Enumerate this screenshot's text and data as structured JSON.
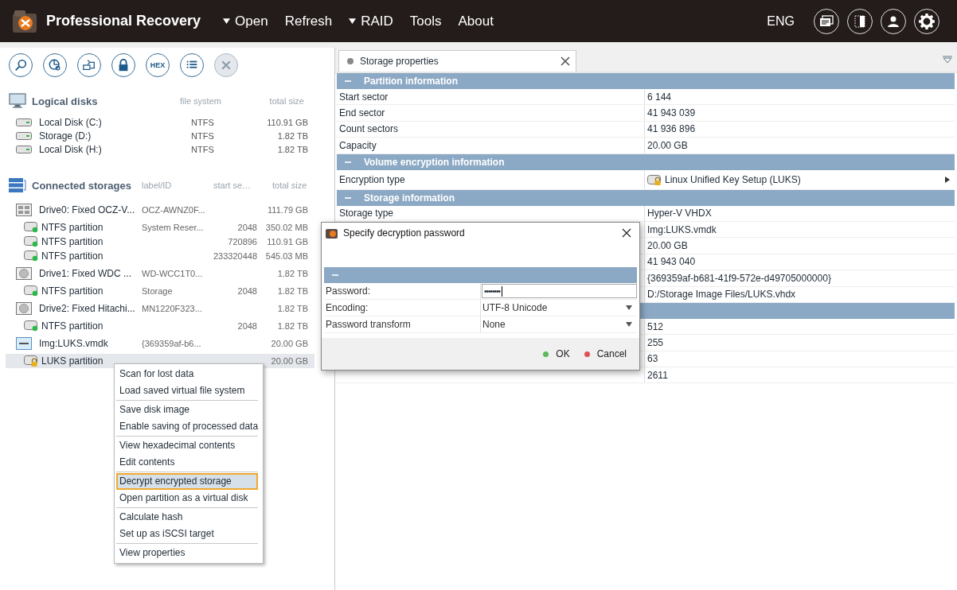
{
  "app": {
    "title": "Professional Recovery",
    "language": "ENG",
    "menu": [
      {
        "label": "Open",
        "caret": true
      },
      {
        "label": "Refresh",
        "caret": false
      },
      {
        "label": "RAID",
        "caret": true
      },
      {
        "label": "Tools",
        "caret": false
      },
      {
        "label": "About",
        "caret": false
      }
    ],
    "header_buttons": [
      {
        "kind": "windows"
      },
      {
        "kind": "panel"
      },
      {
        "kind": "user"
      },
      {
        "kind": "settings"
      }
    ]
  },
  "toolbar": [
    {
      "kind": "search",
      "disabled": false
    },
    {
      "kind": "chart",
      "disabled": false
    },
    {
      "kind": "image",
      "disabled": false
    },
    {
      "kind": "lock",
      "disabled": false
    },
    {
      "kind": "hex",
      "label": "HEX",
      "disabled": false
    },
    {
      "kind": "list",
      "disabled": false
    },
    {
      "kind": "close",
      "disabled": true
    }
  ],
  "logical_disks": {
    "title": "Logical disks",
    "columns": [
      "file system",
      "total size"
    ],
    "items": [
      {
        "name": "Local Disk (C:)",
        "fs": "NTFS",
        "size": "110.91 GB"
      },
      {
        "name": "Storage (D:)",
        "fs": "NTFS",
        "size": "1.82 TB"
      },
      {
        "name": "Local Disk (H:)",
        "fs": "NTFS",
        "size": "1.82 TB"
      }
    ]
  },
  "connected_storages": {
    "title": "Connected storages",
    "columns": [
      "label/ID",
      "start se…",
      "total size"
    ],
    "items": [
      {
        "kind": "ssd",
        "name": "Drive0: Fixed OCZ-V...",
        "label": "OCZ-AWNZ0F...",
        "size": "111.79 GB",
        "selected": false,
        "children": [
          {
            "kind": "ntfs",
            "name": "NTFS partition",
            "label": "System Reser...",
            "start": "2048",
            "size": "350.02 MB",
            "selected": false
          },
          {
            "kind": "ntfs",
            "name": "NTFS partition",
            "start": "720896",
            "size": "110.91 GB",
            "selected": false
          },
          {
            "kind": "ntfs",
            "name": "NTFS partition",
            "start": "233320448",
            "size": "545.03 MB",
            "selected": false
          }
        ]
      },
      {
        "kind": "hdd",
        "name": "Drive1: Fixed WDC ...",
        "label": "WD-WCC1T0...",
        "size": "1.82 TB",
        "selected": false,
        "children": [
          {
            "kind": "ntfs",
            "name": "NTFS partition",
            "label": "Storage",
            "start": "2048",
            "size": "1.82 TB",
            "selected": false
          }
        ]
      },
      {
        "kind": "hdd",
        "name": "Drive2: Fixed Hitachi...",
        "label": "MN1220F323...",
        "size": "1.82 TB",
        "selected": false,
        "children": [
          {
            "kind": "ntfs",
            "name": "NTFS partition",
            "start": "2048",
            "size": "1.82 TB",
            "selected": false
          }
        ]
      },
      {
        "kind": "image",
        "name": "Img:LUKS.vmdk",
        "label": "{369359af-b6...",
        "size": "20.00 GB",
        "selected": false,
        "children": [
          {
            "kind": "luks",
            "name": "LUKS partition",
            "size": "20.00 GB",
            "selected": true
          }
        ]
      }
    ]
  },
  "properties": {
    "tab": {
      "label": "Storage properties",
      "selected": true
    },
    "sections": [
      {
        "title": "Partition information",
        "expanded": true,
        "rows": [
          {
            "kind": "plain",
            "label": "Start sector",
            "value": "6 144"
          },
          {
            "kind": "plain",
            "label": "End sector",
            "value": "41 943 039"
          },
          {
            "kind": "plain",
            "label": "Count sectors",
            "value": "41 936 896"
          },
          {
            "kind": "plain",
            "label": "Capacity",
            "value": "20.00 GB"
          }
        ]
      },
      {
        "title": "Volume encryption information",
        "expanded": true,
        "rows": [
          {
            "kind": "encryption",
            "label": "Encryption type",
            "value": "Linux Unified Key Setup (LUKS)"
          }
        ]
      },
      {
        "title": "Storage information",
        "expanded": true,
        "rows": [
          {
            "kind": "plain",
            "label": "Storage type",
            "value": "Hyper-V VHDX"
          },
          {
            "kind": "plain",
            "value": "Img:LUKS.vmdk"
          },
          {
            "kind": "plain",
            "value": "20.00 GB"
          },
          {
            "kind": "plain",
            "value": "41 943 040"
          },
          {
            "kind": "plain",
            "value": "{369359af-b681-41f9-572e-d49705000000}"
          },
          {
            "kind": "plain",
            "value": "D:/Storage Image Files/LUKS.vhdx"
          }
        ]
      },
      {
        "expanded": true,
        "rows": [
          {
            "kind": "plain",
            "value": "512"
          },
          {
            "kind": "plain",
            "value": "255"
          },
          {
            "kind": "plain",
            "value": "63"
          },
          {
            "kind": "plain",
            "value": "2611"
          }
        ]
      }
    ]
  },
  "context_menu": {
    "groups": [
      {
        "items": [
          {
            "label": "Scan for lost data",
            "selected": false
          },
          {
            "label": "Load saved virtual file system",
            "selected": false
          }
        ]
      },
      {
        "items": [
          {
            "label": "Save disk image",
            "selected": false
          },
          {
            "label": "Enable saving of processed data",
            "selected": false
          }
        ]
      },
      {
        "items": [
          {
            "label": "View hexadecimal contents",
            "selected": false
          },
          {
            "label": "Edit contents",
            "selected": false
          }
        ]
      },
      {
        "items": [
          {
            "label": "Decrypt encrypted storage",
            "selected": true
          },
          {
            "label": "Open partition as a virtual disk",
            "selected": false
          }
        ]
      },
      {
        "items": [
          {
            "label": "Calculate hash",
            "selected": false
          },
          {
            "label": "Set up as iSCSI target",
            "selected": false
          }
        ]
      },
      {
        "items": [
          {
            "label": "View properties",
            "selected": false
          }
        ]
      }
    ]
  },
  "dialog": {
    "title": "Specify decryption password",
    "section_expanded": true,
    "fields": [
      {
        "kind": "password",
        "label": "Password:",
        "value": "••••••••"
      },
      {
        "kind": "dropdown",
        "label": "Encoding:",
        "value": "UTF-8 Unicode"
      },
      {
        "kind": "dropdown",
        "label": "Password transform",
        "value": "None"
      }
    ],
    "buttons": [
      {
        "label": "OK",
        "color": "#5cb85c"
      },
      {
        "label": "Cancel",
        "color": "#e05050"
      }
    ]
  }
}
